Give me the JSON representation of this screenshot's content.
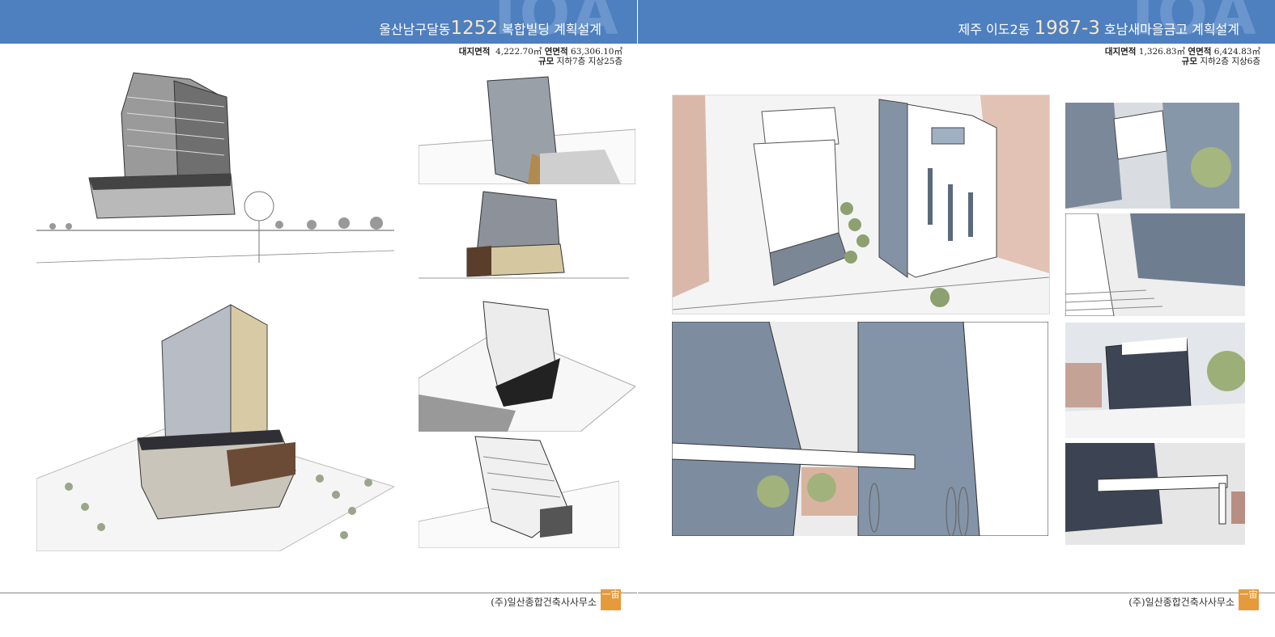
{
  "left_page": {
    "watermark": "IOA",
    "title_prefix": "울산남구달동",
    "title_number": "1252",
    "title_suffix": " 복합빌딩 계획설계",
    "site_area_label": "대지면적",
    "site_area_value": "4,222.70㎡",
    "floor_area_label": "연면적",
    "floor_area_value": "63,306.10㎡",
    "scale_label": "규모",
    "scale_value": "지하7층 지상25층",
    "firm": "(주)일산종합건축사사무소",
    "logo": "一宙"
  },
  "right_page": {
    "watermark": "IOA",
    "title_prefix": "제주 이도2동 ",
    "title_number": "1987-3",
    "title_suffix": " 호남새마을금고 계획설계",
    "site_area_label": "대지면적",
    "site_area_value": "1,326.83㎡",
    "floor_area_label": "연면적",
    "floor_area_value": "6,424.83㎡",
    "scale_label": "규모",
    "scale_value": "지하2층 지상6층",
    "firm": "(주)일산종합건축사사무소",
    "logo": "一宙"
  }
}
